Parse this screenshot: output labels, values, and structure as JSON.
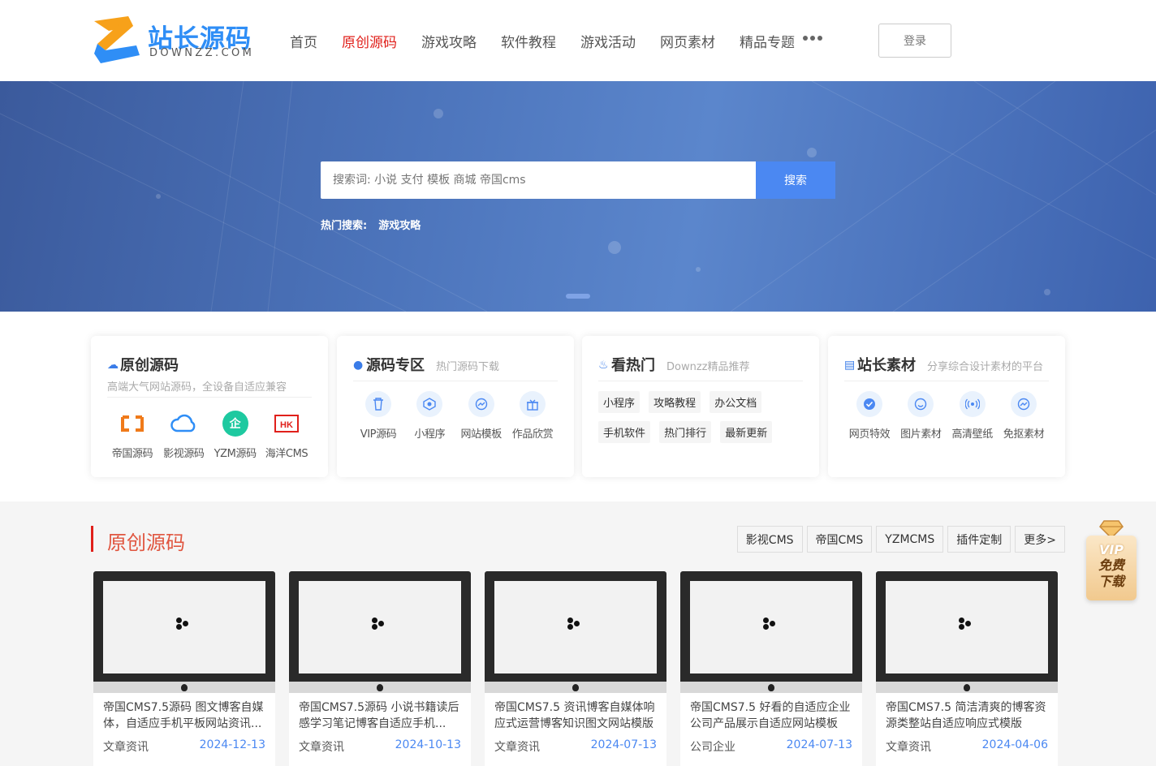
{
  "header": {
    "logo_text": "站长源码",
    "logo_sub": "DOWNZZ.COM",
    "nav": [
      {
        "label": "首页",
        "active": false
      },
      {
        "label": "原创源码",
        "active": true
      },
      {
        "label": "游戏攻略",
        "active": false
      },
      {
        "label": "软件教程",
        "active": false
      },
      {
        "label": "游戏活动",
        "active": false
      },
      {
        "label": "网页素材",
        "active": false
      },
      {
        "label": "精品专题",
        "active": false
      }
    ],
    "more_icon": "more-dots-icon",
    "login_label": "登录"
  },
  "banner": {
    "search_placeholder": "搜索词: 小说 支付 模板 商城 帝国cms",
    "search_button": "搜索",
    "hot_label": "热门搜索:",
    "hot_keywords": [
      "游戏攻略"
    ]
  },
  "cards": {
    "card1": {
      "title": "原创源码",
      "subtitle": "高端大气网站源码，全设备自适应兼容",
      "items": [
        "帝国源码",
        "影视源码",
        "YZM源码",
        "海洋CMS"
      ]
    },
    "card2": {
      "title": "源码专区",
      "subtitle": "热门源码下载",
      "items": [
        "VIP源码",
        "小程序",
        "网站模板",
        "作品欣赏"
      ]
    },
    "card3": {
      "title": "看热门",
      "subtitle": "Downzz精品推荐",
      "tags": [
        "小程序",
        "攻略教程",
        "办公文档",
        "手机软件",
        "热门排行",
        "最新更新"
      ]
    },
    "card4": {
      "title": "站长素材",
      "subtitle": "分享综合设计素材的平台",
      "items": [
        "网页特效",
        "图片素材",
        "高清壁纸",
        "免抠素材"
      ]
    }
  },
  "section": {
    "title": "原创源码",
    "filters": [
      "影视CMS",
      "帝国CMS",
      "YZMCMS",
      "插件定制",
      "更多>"
    ],
    "products": [
      {
        "title": "帝国CMS7.5源码 图文博客自媒体，自适应手机平板网站资讯...",
        "category": "文章资讯",
        "date": "2024-12-13"
      },
      {
        "title": "帝国CMS7.5源码 小说书籍读后感学习笔记博客自适应手机...",
        "category": "文章资讯",
        "date": "2024-10-13"
      },
      {
        "title": "帝国CMS7.5 资讯博客自媒体响应式运营博客知识图文网站模版",
        "category": "文章资讯",
        "date": "2024-07-13"
      },
      {
        "title": "帝国CMS7.5 好看的自适应企业公司产品展示自适应网站模板",
        "category": "公司企业",
        "date": "2024-07-13"
      },
      {
        "title": "帝国CMS7.5 简洁清爽的博客资源类整站自适应响应式模版",
        "category": "文章资讯",
        "date": "2024-04-06"
      }
    ]
  },
  "vip": {
    "badge": "VIP",
    "line1": "免费",
    "line2": "下载"
  },
  "colors": {
    "accent": "#e0201b",
    "brand": "#2f8ef6",
    "button": "#4b88f2"
  }
}
